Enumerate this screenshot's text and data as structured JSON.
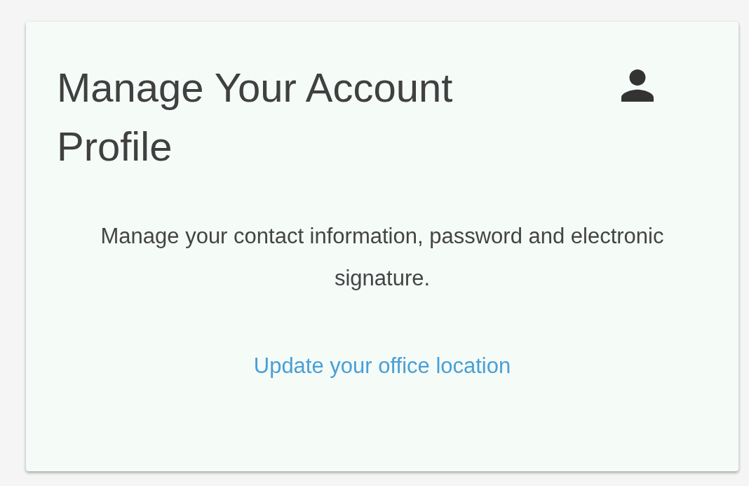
{
  "card": {
    "title": "Manage Your Account Profile",
    "description": "Manage your contact information, password and electronic signature.",
    "link": "Update your office location"
  }
}
